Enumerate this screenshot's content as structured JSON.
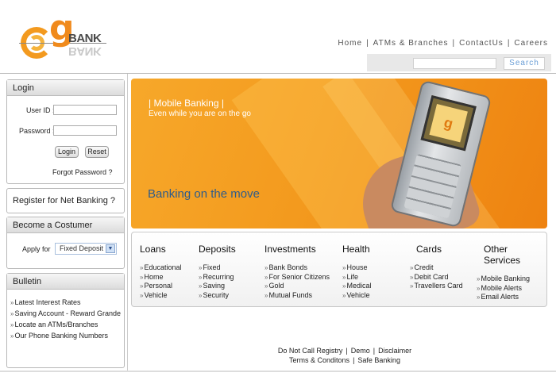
{
  "brand": {
    "logo_letter": "g",
    "logo_text": "BANK"
  },
  "topnav": [
    "Home",
    "ATMs & Branches",
    "ContactUs",
    "Careers"
  ],
  "search": {
    "button_label": "Search",
    "input_value": ""
  },
  "login": {
    "title": "Login",
    "user_id_label": "User ID :",
    "password_label": "Password :",
    "login_button": "Login",
    "reset_button": "Reset",
    "forgot_link": "Forgot Password ?"
  },
  "register": {
    "label": "Register for Net Banking ?"
  },
  "costumer": {
    "title": "Become a Costumer",
    "apply_label": "Apply for",
    "apply_selected": "Fixed Deposit"
  },
  "bulletin": {
    "title": "Bulletin",
    "items": [
      "Latest Interest Rates",
      "Saving Account - Reward Grande",
      "Locate an ATMs/Branches",
      "Our Phone Banking Numbers"
    ]
  },
  "banner": {
    "title": "| Mobile Banking |",
    "subtitle": "Even while you are on the go",
    "tagline": "Banking on the move"
  },
  "services": [
    {
      "heading": "Loans",
      "items": [
        "Educational",
        "Home",
        "Personal",
        "Vehicle"
      ]
    },
    {
      "heading": "Deposits",
      "items": [
        "Fixed",
        "Recurring",
        "Saving",
        "Security"
      ]
    },
    {
      "heading": "Investments",
      "items": [
        "Bank Bonds",
        "For Senior Citizens",
        "Gold",
        "Mutual Funds"
      ]
    },
    {
      "heading": "Health",
      "items": [
        "House",
        "Life",
        "Medical",
        "Vehicle"
      ]
    },
    {
      "heading": "Cards",
      "items": [
        "Credit",
        "Debit Card",
        "Travellers Card"
      ]
    },
    {
      "heading": "Other Services",
      "items": [
        "Mobile Banking",
        "Mobile Alerts",
        "Email Alerts"
      ]
    }
  ],
  "footer": {
    "row1": [
      "Do Not Call Registry",
      "Demo",
      "Disclaimer"
    ],
    "row2": [
      "Terms & Conditons",
      "Safe Banking"
    ]
  },
  "colors": {
    "accent": "#f39a1e",
    "tagline": "#2f5c8a",
    "search_text": "#6a9ed6"
  }
}
